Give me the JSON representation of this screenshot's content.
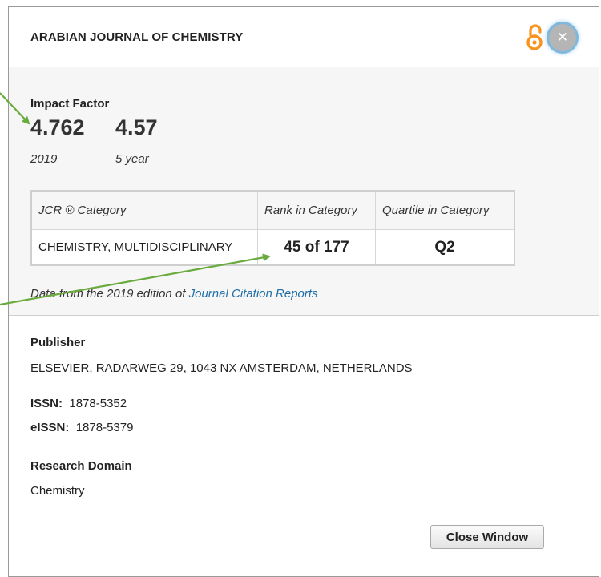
{
  "popup": {
    "journal_title": "ARABIAN JOURNAL OF CHEMISTRY",
    "close_icon_glyph": "✕"
  },
  "impact_factor": {
    "label": "Impact Factor",
    "values": [
      {
        "value": "4.762",
        "caption": "2019"
      },
      {
        "value": "4.57",
        "caption": "5 year"
      }
    ]
  },
  "jcr_table": {
    "headers": [
      "JCR ® Category",
      "Rank in Category",
      "Quartile in Category"
    ],
    "rows": [
      {
        "category": "CHEMISTRY, MULTIDISCIPLINARY",
        "rank": "45 of 177",
        "quartile": "Q2"
      }
    ]
  },
  "data_note": {
    "prefix": "Data from the 2019 edition of ",
    "link_text": "Journal Citation Reports"
  },
  "publisher": {
    "label": "Publisher",
    "value": "ELSEVIER, RADARWEG 29, 1043 NX AMSTERDAM, NETHERLANDS"
  },
  "issn": {
    "label": "ISSN:",
    "value": "1878-5352"
  },
  "eissn": {
    "label": "eISSN:",
    "value": "1878-5379"
  },
  "research_domain": {
    "label": "Research Domain",
    "value": "Chemistry"
  },
  "footer": {
    "close_button_label": "Close Window"
  },
  "colors": {
    "open_access_orange": "#f7931e",
    "link_blue": "#1f6ea6",
    "arrow_green": "#6aab3f",
    "panel_gray": "#f6f6f6"
  }
}
